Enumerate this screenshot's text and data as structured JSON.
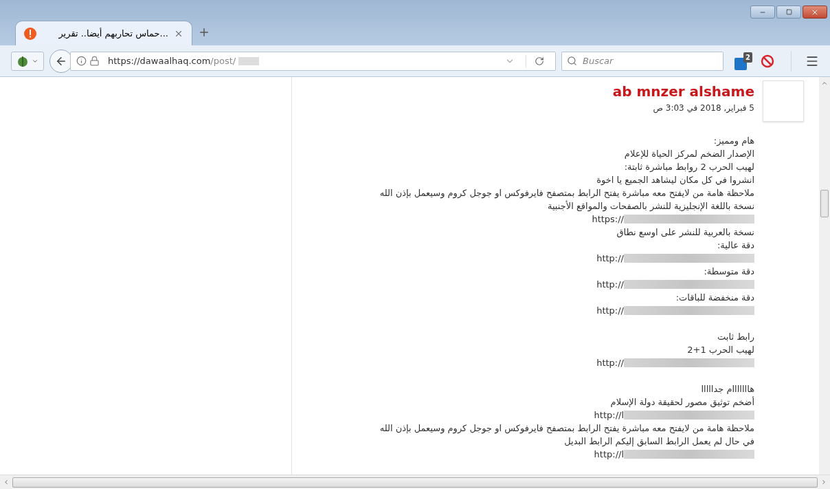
{
  "tab": {
    "title": "...حماس تحاربهم أيضا.. تقرير",
    "selected": true
  },
  "address_bar": {
    "url_host": "https://dawaalhaq.com",
    "url_path": "/post/"
  },
  "search": {
    "placeholder": "Buscar"
  },
  "extension_badge": "2",
  "post": {
    "author": "ab mnzer alshame",
    "date": "5 فبراير, 2018 في 3:03 ص",
    "paragraphs": [
      [
        {
          "kind": "text",
          "text": "هام ومميز:"
        },
        {
          "kind": "text",
          "text": "الإصدار الضخم لمركز الحياة للإعلام"
        },
        {
          "kind": "text",
          "text": "لهيب الحرب 2 روابط مباشرة ثابتة:"
        },
        {
          "kind": "text",
          "text": "انشروا في كل مكان ليشاهد الجميع يا اخوة"
        },
        {
          "kind": "text",
          "text": "ملاحظة هامة من لايفتح معه مباشرة يفتح الرابط بمتصفح فايرفوكس او جوجل كروم وسيعمل بإذن الله"
        },
        {
          "kind": "text",
          "text": "نسخة باللغة الإنجليزية للنشر بالصفحات والمواقع الأجنبية"
        },
        {
          "kind": "link",
          "text": "https://"
        },
        {
          "kind": "text",
          "text": "نسخة بالعربية للنشر على اوسع نطاق"
        },
        {
          "kind": "text",
          "text": "دقة عالية:"
        },
        {
          "kind": "link",
          "text": "http://"
        },
        {
          "kind": "text",
          "text": "دقة متوسطة:"
        },
        {
          "kind": "link",
          "text": "http://"
        },
        {
          "kind": "text",
          "text": "دقة منخفضة للباقات:"
        },
        {
          "kind": "link",
          "text": "http://"
        }
      ],
      [
        {
          "kind": "text",
          "text": "رابط ثابت"
        },
        {
          "kind": "text",
          "text": "لهيب الحرب 1+2"
        },
        {
          "kind": "link",
          "text": "http://"
        }
      ],
      [
        {
          "kind": "text",
          "text": "هااااااام جدااااا"
        },
        {
          "kind": "text",
          "text": "أضخم توثيق مصور لحقيقة دولة الإسلام"
        },
        {
          "kind": "link",
          "text": "http://l"
        },
        {
          "kind": "text",
          "text": "ملاحظة هامة من لايفتح معه مباشرة يفتح الرابط بمتصفح فايرفوكس او جوجل كروم وسيعمل بإذن الله"
        },
        {
          "kind": "text",
          "text": "في حال لم يعمل الرابط السابق إليكم الرابط البديل"
        },
        {
          "kind": "link",
          "text": "http://l"
        }
      ]
    ]
  }
}
